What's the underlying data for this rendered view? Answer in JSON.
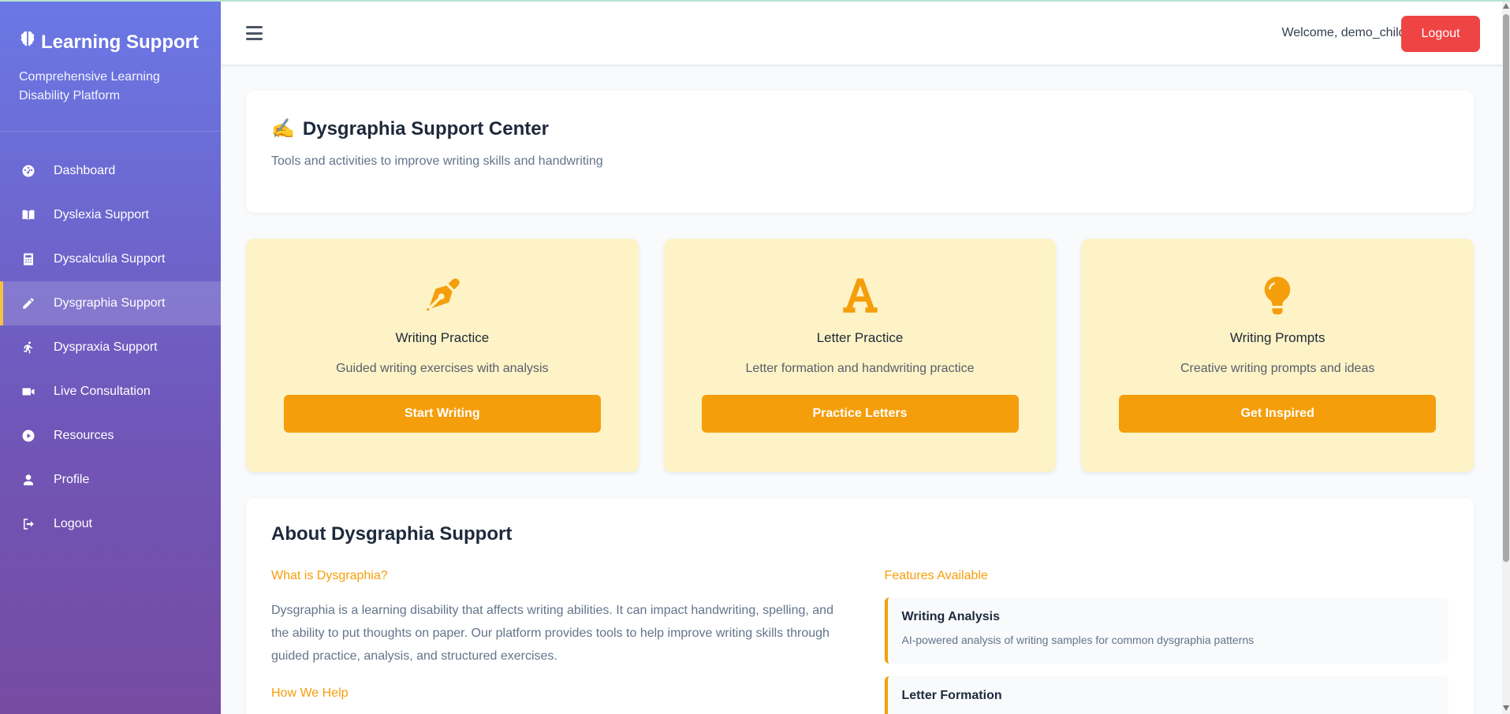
{
  "sidebar": {
    "title": "Learning Support",
    "brand_icon": "brain-icon",
    "subtitle": "Comprehensive Learning Disability Platform",
    "accent_color": "#f5c142",
    "items": [
      {
        "label": "Dashboard",
        "icon": "dashboard-icon"
      },
      {
        "label": "Dyslexia Support",
        "icon": "book-icon"
      },
      {
        "label": "Dyscalculia Support",
        "icon": "calculator-icon"
      },
      {
        "label": "Dysgraphia Support",
        "icon": "pencil-icon",
        "active": true
      },
      {
        "label": "Dyspraxia Support",
        "icon": "running-icon"
      },
      {
        "label": "Live Consultation",
        "icon": "video-icon"
      },
      {
        "label": "Resources",
        "icon": "play-circle-icon"
      },
      {
        "label": "Profile",
        "icon": "user-icon"
      },
      {
        "label": "Logout",
        "icon": "sign-out-icon"
      }
    ]
  },
  "topbar": {
    "welcome": "Welcome, demo_child!",
    "logout_label": "Logout",
    "logout_color": "#ef4444"
  },
  "header": {
    "emoji": "✍️",
    "title": "Dysgraphia Support Center",
    "subtitle": "Tools and activities to improve writing skills and handwriting"
  },
  "features": [
    {
      "title": "Writing Practice",
      "description": "Guided writing exercises with analysis",
      "button": "Start Writing",
      "icon": "pen-nib-icon"
    },
    {
      "title": "Letter Practice",
      "description": "Letter formation and handwriting practice",
      "button": "Practice Letters",
      "icon": "font-icon"
    },
    {
      "title": "Writing Prompts",
      "description": "Creative writing prompts and ideas",
      "button": "Get Inspired",
      "icon": "lightbulb-icon"
    }
  ],
  "feature_color": "#f59e0b",
  "about": {
    "title": "About Dysgraphia Support",
    "what_heading": "What is Dysgraphia?",
    "what_text": "Dysgraphia is a learning disability that affects writing abilities. It can impact handwriting, spelling, and the ability to put thoughts on paper. Our platform provides tools to help improve writing skills through guided practice, analysis, and structured exercises.",
    "how_heading": "How We Help",
    "features_heading": "Features Available",
    "feature_list": [
      {
        "title": "Writing Analysis",
        "description": "AI-powered analysis of writing samples for common dysgraphia patterns"
      },
      {
        "title": "Letter Formation",
        "description": ""
      }
    ]
  }
}
